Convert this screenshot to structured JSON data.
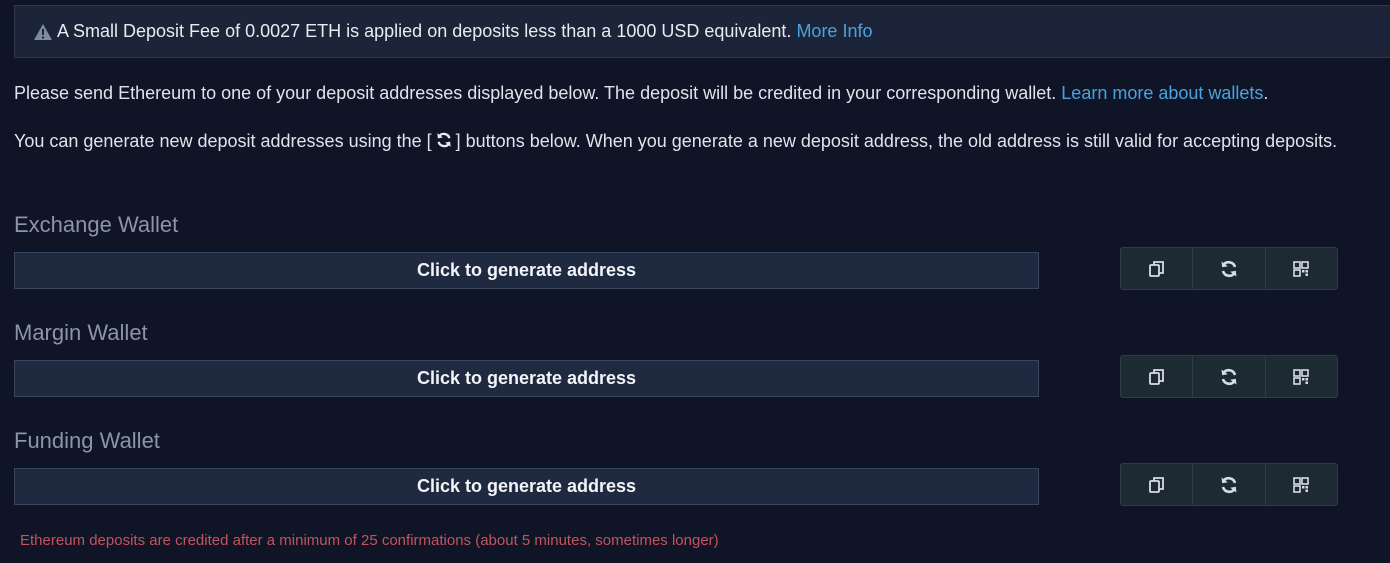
{
  "notice": {
    "text": "A Small Deposit Fee of 0.0027 ETH is applied on deposits less than a 1000 USD equivalent.",
    "link": "More Info",
    "icon": "warning-icon"
  },
  "intro": {
    "text": "Please send Ethereum to one of your deposit addresses displayed below. The deposit will be credited in your corresponding wallet. ",
    "link": "Learn more about wallets",
    "suffix": "."
  },
  "generate_note": {
    "before": "You can generate new deposit addresses using the [",
    "after": "] buttons below. When you generate a new deposit address, the old address is still valid for accepting deposits."
  },
  "wallets": [
    {
      "title": "Exchange Wallet",
      "address_label": "Click to generate address"
    },
    {
      "title": "Margin Wallet",
      "address_label": "Click to generate address"
    },
    {
      "title": "Funding Wallet",
      "address_label": "Click to generate address"
    }
  ],
  "buttons": [
    "copy-icon",
    "refresh-icon",
    "qr-code-icon"
  ],
  "footnote": "Ethereum deposits are credited after a minimum of 25 confirmations (about 5 minutes, sometimes longer)",
  "colors": {
    "background": "#0f1427",
    "link": "#4aa3df",
    "footnote": "#c4535c"
  }
}
